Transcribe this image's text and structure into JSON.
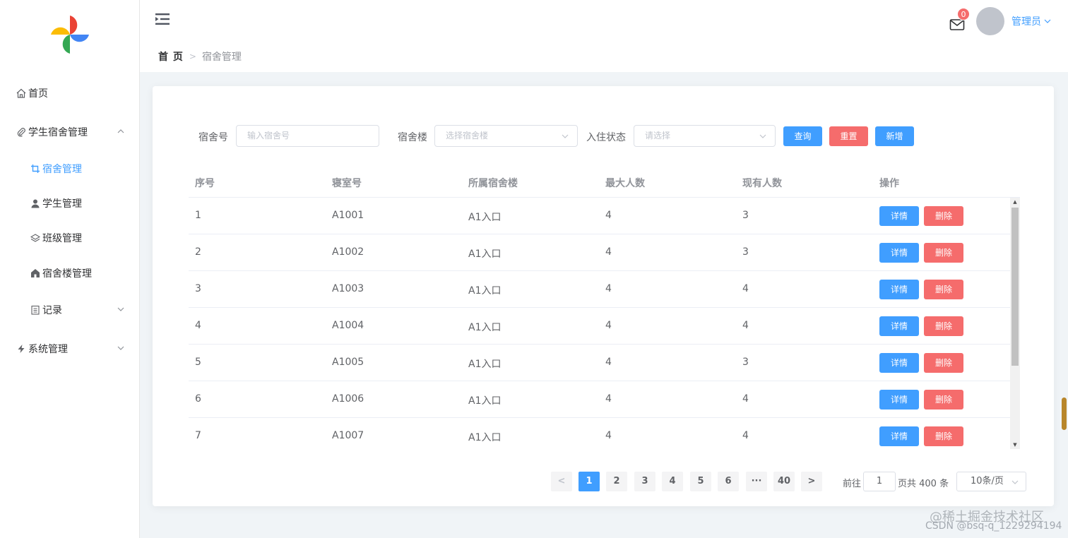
{
  "sidebar": {
    "items": [
      {
        "label": "首页",
        "icon": "home-icon"
      },
      {
        "label": "学生宿舍管理",
        "icon": "paperclip-icon",
        "expanded": true
      },
      {
        "label": "宿舍管理",
        "icon": "crop-icon",
        "active": true
      },
      {
        "label": "学生管理",
        "icon": "user-icon"
      },
      {
        "label": "班级管理",
        "icon": "layers-icon"
      },
      {
        "label": "宿舍楼管理",
        "icon": "house-icon"
      },
      {
        "label": "记录",
        "icon": "notebook-icon"
      },
      {
        "label": "系统管理",
        "icon": "lightning-icon"
      }
    ]
  },
  "header": {
    "breadcrumb": {
      "home": "首 页",
      "separator": ">",
      "current": "宿舍管理"
    },
    "notifications": "0",
    "user": "管理员"
  },
  "filters": {
    "room_label": "宿舍号",
    "room_placeholder": "输入宿舍号",
    "building_label": "宿舍楼",
    "building_placeholder": "选择宿舍楼",
    "status_label": "入住状态",
    "status_placeholder": "请选择",
    "query_label": "查询",
    "reset_label": "重置",
    "add_label": "新增"
  },
  "table": {
    "columns": [
      "序号",
      "寝室号",
      "所属宿舍楼",
      "最大人数",
      "现有人数",
      "操作"
    ],
    "rows": [
      [
        "1",
        "A1001",
        "A1入口",
        "4",
        "3"
      ],
      [
        "2",
        "A1002",
        "A1入口",
        "4",
        "3"
      ],
      [
        "3",
        "A1003",
        "A1入口",
        "4",
        "4"
      ],
      [
        "4",
        "A1004",
        "A1入口",
        "4",
        "4"
      ],
      [
        "5",
        "A1005",
        "A1入口",
        "4",
        "3"
      ],
      [
        "6",
        "A1006",
        "A1入口",
        "4",
        "4"
      ],
      [
        "7",
        "A1007",
        "A1入口",
        "4",
        "4"
      ]
    ],
    "detail_label": "详情",
    "delete_label": "删除"
  },
  "pagination": {
    "prev": "<",
    "pages": [
      "1",
      "2",
      "3",
      "4",
      "5",
      "6",
      "···",
      "40"
    ],
    "next": ">",
    "goto_label": "前往",
    "current_page": "1",
    "total_text": "页共 400 条",
    "page_size": "10条/页"
  },
  "watermark": {
    "line1": "@稀土掘金技术社区",
    "line2": "CSDN @bsq-q_1229294194"
  },
  "colors": {
    "primary": "#409eff",
    "danger": "#f56c6c",
    "background": "#f0f4f7"
  }
}
